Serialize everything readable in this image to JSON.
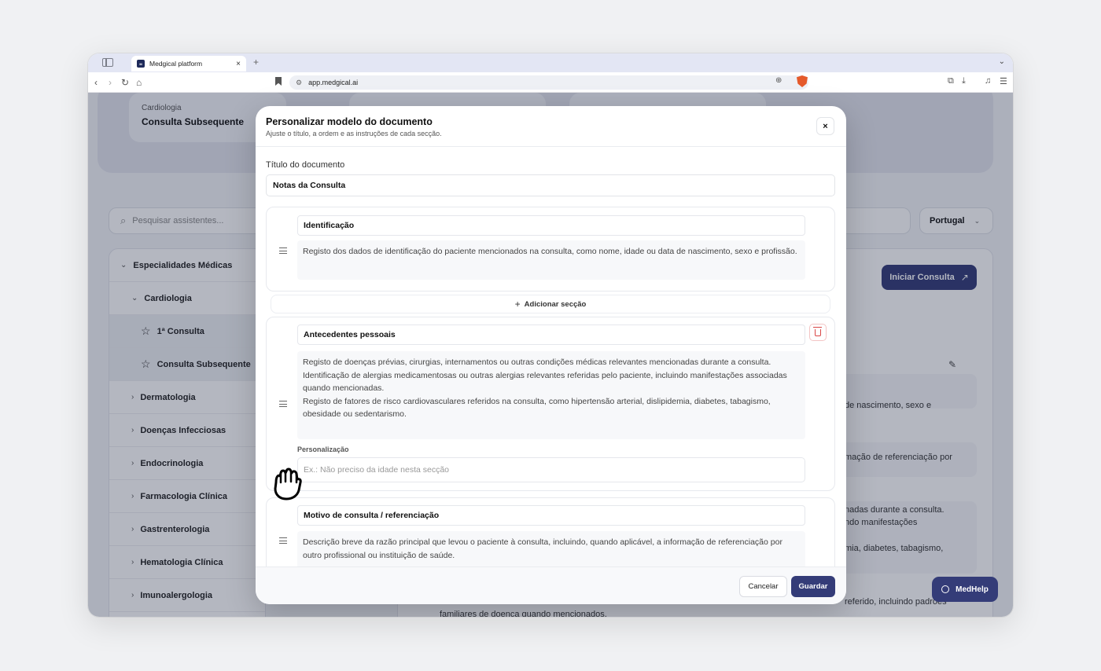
{
  "browser": {
    "tab_title": "Medgical platform",
    "tab_close": "×",
    "new_tab": "+",
    "url": "app.medgical.ai"
  },
  "page": {
    "hero_card": {
      "subtitle": "Cardiologia",
      "title": "Consulta Subsequente"
    },
    "search_placeholder": "Pesquisar assistentes...",
    "country": "Portugal",
    "tree": [
      {
        "label": "Especialidades Médicas",
        "kind": "expanded"
      },
      {
        "label": "Cardiologia",
        "kind": "expanded"
      },
      {
        "label": "1ª Consulta",
        "kind": "star"
      },
      {
        "label": "Consulta Subsequente",
        "kind": "star"
      },
      {
        "label": "Dermatologia",
        "kind": "collapsed"
      },
      {
        "label": "Doenças Infecciosas",
        "kind": "collapsed"
      },
      {
        "label": "Endocrinologia",
        "kind": "collapsed"
      },
      {
        "label": "Farmacologia Clínica",
        "kind": "collapsed"
      },
      {
        "label": "Gastrenterologia",
        "kind": "collapsed"
      },
      {
        "label": "Hematologia Clínica",
        "kind": "collapsed"
      },
      {
        "label": "Imunoalergologia",
        "kind": "collapsed"
      }
    ],
    "start_button": "Iniciar Consulta",
    "bg_snippets": [
      "de nascimento, sexo e",
      "mação de referenciação por",
      "nadas durante a consulta.",
      "ndo manifestações",
      "mia, diabetes, tabagismo,",
      "referido, incluindo padrões",
      "familiares de doença quando mencionados."
    ],
    "medhelp": "MedHelp"
  },
  "modal": {
    "title": "Personalizar modelo do documento",
    "subtitle": "Ajuste o título, a ordem e as instruções de cada secção.",
    "close": "×",
    "doc_title_label": "Título do documento",
    "doc_title_value": "Notas da Consulta",
    "add_section": "Adicionar secção",
    "sections": [
      {
        "heading": "Identificação",
        "description": "Registo dos dados de identificação do paciente mencionados na consulta, como nome, idade ou data de nascimento, sexo e profissão."
      },
      {
        "heading": "Antecedentes pessoais",
        "description_lines": [
          "Registo de doenças prévias, cirurgias, internamentos ou outras condições médicas relevantes mencionadas durante a consulta.",
          "Identificação de alergias medicamentosas ou outras alergias relevantes referidas pelo paciente, incluindo manifestações associadas quando mencionadas.",
          "Registo de fatores de risco cardiovasculares referidos na consulta, como hipertensão arterial, dislipidemia, diabetes, tabagismo, obesidade ou sedentarismo."
        ],
        "custom_label": "Personalização",
        "custom_placeholder": "Ex.: Não preciso da idade nesta secção"
      },
      {
        "heading": "Motivo de consulta / referenciação",
        "description": "Descrição breve da razão principal que levou o paciente à consulta, incluindo, quando aplicável, a informação de referenciação por outro profissional ou instituição de saúde."
      }
    ],
    "cancel": "Cancelar",
    "save": "Guardar"
  },
  "colors": {
    "accent": "#343c78",
    "danger": "#d94646"
  }
}
